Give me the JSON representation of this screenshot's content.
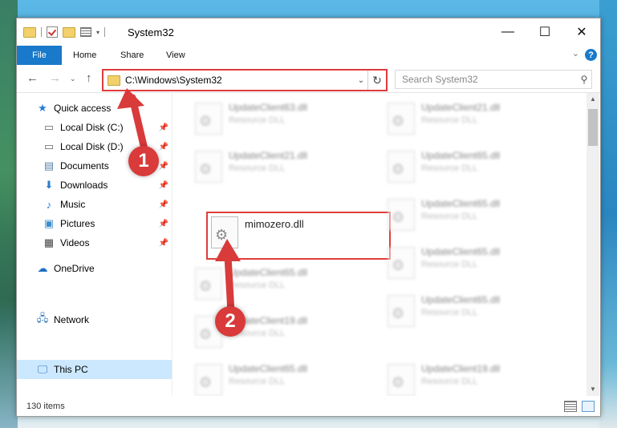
{
  "window": {
    "title": "System32",
    "minimize": "—",
    "maximize": "☐",
    "close": "✕"
  },
  "ribbon": {
    "file": "File",
    "home": "Home",
    "share": "Share",
    "view": "View",
    "help": "?"
  },
  "address": {
    "path": "C:\\Windows\\System32",
    "search_placeholder": "Search System32"
  },
  "sidebar": {
    "quick_access": "Quick access",
    "items": [
      {
        "label": "Local Disk (C:)",
        "icon": "drive-icon"
      },
      {
        "label": "Local Disk (D:)",
        "icon": "drive-icon"
      },
      {
        "label": "Documents",
        "icon": "documents-icon"
      },
      {
        "label": "Downloads",
        "icon": "downloads-icon"
      },
      {
        "label": "Music",
        "icon": "music-icon"
      },
      {
        "label": "Pictures",
        "icon": "pictures-icon"
      },
      {
        "label": "Videos",
        "icon": "videos-icon"
      }
    ],
    "onedrive": "OneDrive",
    "this_pc": "This PC",
    "network": "Network"
  },
  "files": {
    "highlighted": {
      "name": "mimozero.dll"
    },
    "left_column": [
      {
        "name": "UpdateClient63.dll",
        "type": "Resource DLL"
      },
      {
        "name": "UpdateClient21.dll",
        "type": "Resource DLL"
      },
      {
        "name": "UpdateClient65.dll",
        "type": "Resource DLL"
      },
      {
        "name": "UpdateClient19.dll",
        "type": "Resource DLL"
      },
      {
        "name": "UpdateClient65.dll",
        "type": "Resource DLL"
      }
    ],
    "right_column": [
      {
        "name": "UpdateClient21.dll",
        "type": "Resource DLL"
      },
      {
        "name": "UpdateClient65.dll",
        "type": "Resource DLL"
      },
      {
        "name": "UpdateClient65.dll",
        "type": "Resource DLL"
      },
      {
        "name": "UpdateClient65.dll",
        "type": "Resource DLL"
      },
      {
        "name": "UpdateClient65.dll",
        "type": "Resource DLL"
      },
      {
        "name": "UpdateClient19.dll",
        "type": "Resource DLL"
      }
    ]
  },
  "status": {
    "item_count": "130 items"
  },
  "annotations": {
    "step1": "1",
    "step2": "2",
    "color": "#d93a3a"
  }
}
